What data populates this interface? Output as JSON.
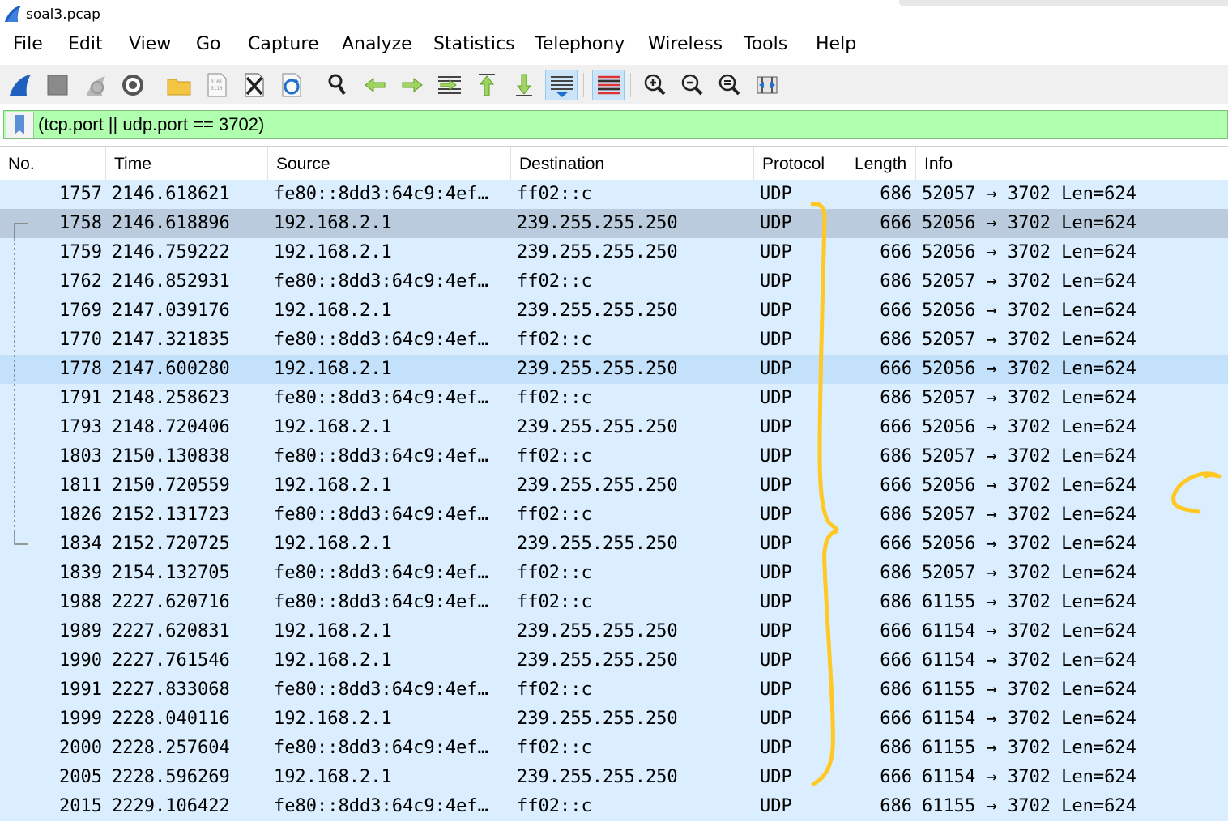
{
  "window": {
    "title": "soal3.pcap"
  },
  "menu": [
    "File",
    "Edit",
    "View",
    "Go",
    "Capture",
    "Analyze",
    "Statistics",
    "Telephony",
    "Wireless",
    "Tools",
    "Help"
  ],
  "toolbar": {
    "icons": [
      "start-capture-icon",
      "stop-capture-icon",
      "restart-capture-icon",
      "capture-options-icon",
      "open-file-icon",
      "save-file-icon",
      "close-file-icon",
      "reload-file-icon",
      "find-packet-icon",
      "go-back-icon",
      "go-forward-icon",
      "go-to-packet-icon",
      "go-first-packet-icon",
      "go-last-packet-icon",
      "auto-scroll-icon",
      "colorize-icon",
      "zoom-in-icon",
      "zoom-out-icon",
      "normal-size-icon",
      "resize-columns-icon"
    ]
  },
  "filter": {
    "value": "(tcp.port || udp.port == 3702)"
  },
  "columns": [
    "No.",
    "Time",
    "Source",
    "Destination",
    "Protocol",
    "Length",
    "Info"
  ],
  "packets": [
    {
      "no": "1757",
      "time": "2146.618621",
      "src": "fe80::8dd3:64c9:4ef…",
      "dst": "ff02::c",
      "proto": "UDP",
      "len": "686",
      "info": "52057 → 3702 Len=624"
    },
    {
      "no": "1758",
      "time": "2146.618896",
      "src": "192.168.2.1",
      "dst": "239.255.255.250",
      "proto": "UDP",
      "len": "666",
      "info": "52056 → 3702 Len=624"
    },
    {
      "no": "1759",
      "time": "2146.759222",
      "src": "192.168.2.1",
      "dst": "239.255.255.250",
      "proto": "UDP",
      "len": "666",
      "info": "52056 → 3702 Len=624"
    },
    {
      "no": "1762",
      "time": "2146.852931",
      "src": "fe80::8dd3:64c9:4ef…",
      "dst": "ff02::c",
      "proto": "UDP",
      "len": "686",
      "info": "52057 → 3702 Len=624"
    },
    {
      "no": "1769",
      "time": "2147.039176",
      "src": "192.168.2.1",
      "dst": "239.255.255.250",
      "proto": "UDP",
      "len": "666",
      "info": "52056 → 3702 Len=624"
    },
    {
      "no": "1770",
      "time": "2147.321835",
      "src": "fe80::8dd3:64c9:4ef…",
      "dst": "ff02::c",
      "proto": "UDP",
      "len": "686",
      "info": "52057 → 3702 Len=624"
    },
    {
      "no": "1778",
      "time": "2147.600280",
      "src": "192.168.2.1",
      "dst": "239.255.255.250",
      "proto": "UDP",
      "len": "666",
      "info": "52056 → 3702 Len=624"
    },
    {
      "no": "1791",
      "time": "2148.258623",
      "src": "fe80::8dd3:64c9:4ef…",
      "dst": "ff02::c",
      "proto": "UDP",
      "len": "686",
      "info": "52057 → 3702 Len=624"
    },
    {
      "no": "1793",
      "time": "2148.720406",
      "src": "192.168.2.1",
      "dst": "239.255.255.250",
      "proto": "UDP",
      "len": "666",
      "info": "52056 → 3702 Len=624"
    },
    {
      "no": "1803",
      "time": "2150.130838",
      "src": "fe80::8dd3:64c9:4ef…",
      "dst": "ff02::c",
      "proto": "UDP",
      "len": "686",
      "info": "52057 → 3702 Len=624"
    },
    {
      "no": "1811",
      "time": "2150.720559",
      "src": "192.168.2.1",
      "dst": "239.255.255.250",
      "proto": "UDP",
      "len": "666",
      "info": "52056 → 3702 Len=624"
    },
    {
      "no": "1826",
      "time": "2152.131723",
      "src": "fe80::8dd3:64c9:4ef…",
      "dst": "ff02::c",
      "proto": "UDP",
      "len": "686",
      "info": "52057 → 3702 Len=624"
    },
    {
      "no": "1834",
      "time": "2152.720725",
      "src": "192.168.2.1",
      "dst": "239.255.255.250",
      "proto": "UDP",
      "len": "666",
      "info": "52056 → 3702 Len=624"
    },
    {
      "no": "1839",
      "time": "2154.132705",
      "src": "fe80::8dd3:64c9:4ef…",
      "dst": "ff02::c",
      "proto": "UDP",
      "len": "686",
      "info": "52057 → 3702 Len=624"
    },
    {
      "no": "1988",
      "time": "2227.620716",
      "src": "fe80::8dd3:64c9:4ef…",
      "dst": "ff02::c",
      "proto": "UDP",
      "len": "686",
      "info": "61155 → 3702 Len=624"
    },
    {
      "no": "1989",
      "time": "2227.620831",
      "src": "192.168.2.1",
      "dst": "239.255.255.250",
      "proto": "UDP",
      "len": "666",
      "info": "61154 → 3702 Len=624"
    },
    {
      "no": "1990",
      "time": "2227.761546",
      "src": "192.168.2.1",
      "dst": "239.255.255.250",
      "proto": "UDP",
      "len": "666",
      "info": "61154 → 3702 Len=624"
    },
    {
      "no": "1991",
      "time": "2227.833068",
      "src": "fe80::8dd3:64c9:4ef…",
      "dst": "ff02::c",
      "proto": "UDP",
      "len": "686",
      "info": "61155 → 3702 Len=624"
    },
    {
      "no": "1999",
      "time": "2228.040116",
      "src": "192.168.2.1",
      "dst": "239.255.255.250",
      "proto": "UDP",
      "len": "666",
      "info": "61154 → 3702 Len=624"
    },
    {
      "no": "2000",
      "time": "2228.257604",
      "src": "fe80::8dd3:64c9:4ef…",
      "dst": "ff02::c",
      "proto": "UDP",
      "len": "686",
      "info": "61155 → 3702 Len=624"
    },
    {
      "no": "2005",
      "time": "2228.596269",
      "src": "192.168.2.1",
      "dst": "239.255.255.250",
      "proto": "UDP",
      "len": "666",
      "info": "61154 → 3702 Len=624"
    },
    {
      "no": "2015",
      "time": "2229.106422",
      "src": "fe80::8dd3:64c9:4ef…",
      "dst": "ff02::c",
      "proto": "UDP",
      "len": "686",
      "info": "61155 → 3702 Len=624"
    }
  ],
  "selected_packet": "1758",
  "hovered_packet": "1778",
  "colors": {
    "row_bg": "#daeeff",
    "selected_bg": "#b9cbdc",
    "hover_bg": "#c4e1fb",
    "filter_bg": "#afffaf",
    "annotation": "#ffc824"
  }
}
